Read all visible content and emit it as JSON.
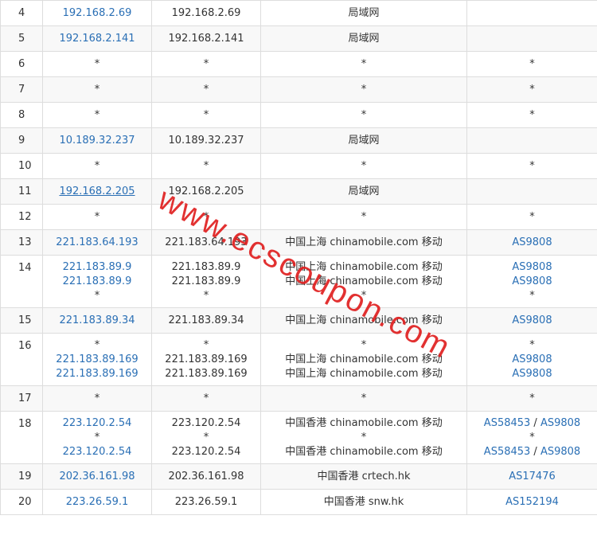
{
  "watermark": "www.ecscoupon.com",
  "rows": [
    {
      "hop": "4",
      "ips": [
        "192.168.2.69"
      ],
      "hosts": [
        "192.168.2.69"
      ],
      "locs": [
        "局域网"
      ],
      "as": [
        []
      ]
    },
    {
      "hop": "5",
      "ips": [
        "192.168.2.141"
      ],
      "hosts": [
        "192.168.2.141"
      ],
      "locs": [
        "局域网"
      ],
      "as": [
        []
      ]
    },
    {
      "hop": "6",
      "ips": [
        "*"
      ],
      "hosts": [
        "*"
      ],
      "locs": [
        "*"
      ],
      "as": [
        [
          "*"
        ]
      ]
    },
    {
      "hop": "7",
      "ips": [
        "*"
      ],
      "hosts": [
        "*"
      ],
      "locs": [
        "*"
      ],
      "as": [
        [
          "*"
        ]
      ]
    },
    {
      "hop": "8",
      "ips": [
        "*"
      ],
      "hosts": [
        "*"
      ],
      "locs": [
        "*"
      ],
      "as": [
        [
          "*"
        ]
      ]
    },
    {
      "hop": "9",
      "ips": [
        "10.189.32.237"
      ],
      "hosts": [
        "10.189.32.237"
      ],
      "locs": [
        "局域网"
      ],
      "as": [
        []
      ]
    },
    {
      "hop": "10",
      "ips": [
        "*"
      ],
      "hosts": [
        "*"
      ],
      "locs": [
        "*"
      ],
      "as": [
        [
          "*"
        ]
      ]
    },
    {
      "hop": "11",
      "ips": [
        "192.168.2.205"
      ],
      "hosts": [
        "192.168.2.205"
      ],
      "locs": [
        "局域网"
      ],
      "as": [
        []
      ],
      "underline": true
    },
    {
      "hop": "12",
      "ips": [
        "*"
      ],
      "hosts": [
        "*"
      ],
      "locs": [
        "*"
      ],
      "as": [
        [
          "*"
        ]
      ]
    },
    {
      "hop": "13",
      "ips": [
        "221.183.64.193"
      ],
      "hosts": [
        "221.183.64.193"
      ],
      "locs": [
        "中国上海 chinamobile.com 移动"
      ],
      "as": [
        [
          "AS9808"
        ]
      ]
    },
    {
      "hop": "14",
      "ips": [
        "221.183.89.9",
        "221.183.89.9",
        "*"
      ],
      "hosts": [
        "221.183.89.9",
        "221.183.89.9",
        "*"
      ],
      "locs": [
        "中国上海 chinamobile.com 移动",
        "中国上海 chinamobile.com 移动",
        "*"
      ],
      "as": [
        [
          "AS9808"
        ],
        [
          "AS9808"
        ],
        [
          "*"
        ]
      ]
    },
    {
      "hop": "15",
      "ips": [
        "221.183.89.34"
      ],
      "hosts": [
        "221.183.89.34"
      ],
      "locs": [
        "中国上海 chinamobile.com 移动"
      ],
      "as": [
        [
          "AS9808"
        ]
      ]
    },
    {
      "hop": "16",
      "ips": [
        "*",
        "221.183.89.169",
        "221.183.89.169"
      ],
      "hosts": [
        "*",
        "221.183.89.169",
        "221.183.89.169"
      ],
      "locs": [
        "*",
        "中国上海 chinamobile.com 移动",
        "中国上海 chinamobile.com 移动"
      ],
      "as": [
        [
          "*"
        ],
        [
          "AS9808"
        ],
        [
          "AS9808"
        ]
      ]
    },
    {
      "hop": "17",
      "ips": [
        "*"
      ],
      "hosts": [
        "*"
      ],
      "locs": [
        "*"
      ],
      "as": [
        [
          "*"
        ]
      ]
    },
    {
      "hop": "18",
      "ips": [
        "223.120.2.54",
        "*",
        "223.120.2.54"
      ],
      "hosts": [
        "223.120.2.54",
        "*",
        "223.120.2.54"
      ],
      "locs": [
        "中国香港 chinamobile.com 移动",
        "*",
        "中国香港 chinamobile.com 移动"
      ],
      "as": [
        [
          "AS58453",
          "AS9808"
        ],
        [
          "*"
        ],
        [
          "AS58453",
          "AS9808"
        ]
      ]
    },
    {
      "hop": "19",
      "ips": [
        "202.36.161.98"
      ],
      "hosts": [
        "202.36.161.98"
      ],
      "locs": [
        "中国香港 crtech.hk"
      ],
      "as": [
        [
          "AS17476"
        ]
      ]
    },
    {
      "hop": "20",
      "ips": [
        "223.26.59.1"
      ],
      "hosts": [
        "223.26.59.1"
      ],
      "locs": [
        "中国香港 snw.hk"
      ],
      "as": [
        [
          "AS152194"
        ]
      ]
    }
  ]
}
